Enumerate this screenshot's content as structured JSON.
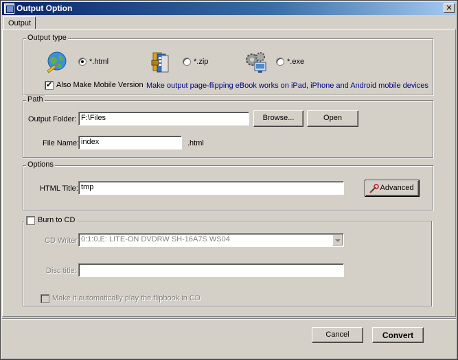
{
  "window": {
    "title": "Output Option",
    "close_glyph": "✕"
  },
  "tabs": [
    {
      "label": "Output"
    }
  ],
  "output_type": {
    "group_label": "Output type",
    "options": [
      {
        "label": "*.html",
        "icon": "globe-html-icon",
        "checked": true
      },
      {
        "label": "*.zip",
        "icon": "zip-archive-icon",
        "checked": false
      },
      {
        "label": "*.exe",
        "icon": "exe-gears-icon",
        "checked": false
      }
    ],
    "mobile_checkbox_label": "Also Make Mobile Version",
    "mobile_checked": true,
    "mobile_note": "Make output page-flipping eBook works on iPad, iPhone and Android mobile devices"
  },
  "path": {
    "group_label": "Path",
    "output_folder_label": "Output Folder:",
    "output_folder_value": "F:\\Files",
    "browse_label": "Browse...",
    "open_label": "Open",
    "file_name_label": "File Name:",
    "file_name_value": "index",
    "file_ext": ".html"
  },
  "options": {
    "group_label": "Options",
    "html_title_label": "HTML Title:",
    "html_title_value": "tmp",
    "advanced_label": "Advanced"
  },
  "burn": {
    "checkbox_label": "Burn to CD",
    "checked": false,
    "cd_writer_label": "CD Writer",
    "cd_writer_value": "0:1:0,E: LITE-ON  DVDRW SH-16A7S   WS04",
    "disc_title_label": "Disc title:",
    "disc_title_value": "",
    "autoplay_label": "Make it automatically play the flipbook in CD",
    "autoplay_checked": false
  },
  "footer": {
    "cancel_label": "Cancel",
    "convert_label": "Convert"
  },
  "colors": {
    "titlebar_start": "#0a246a",
    "face": "#d4d0c8",
    "note_blue": "#000080"
  }
}
